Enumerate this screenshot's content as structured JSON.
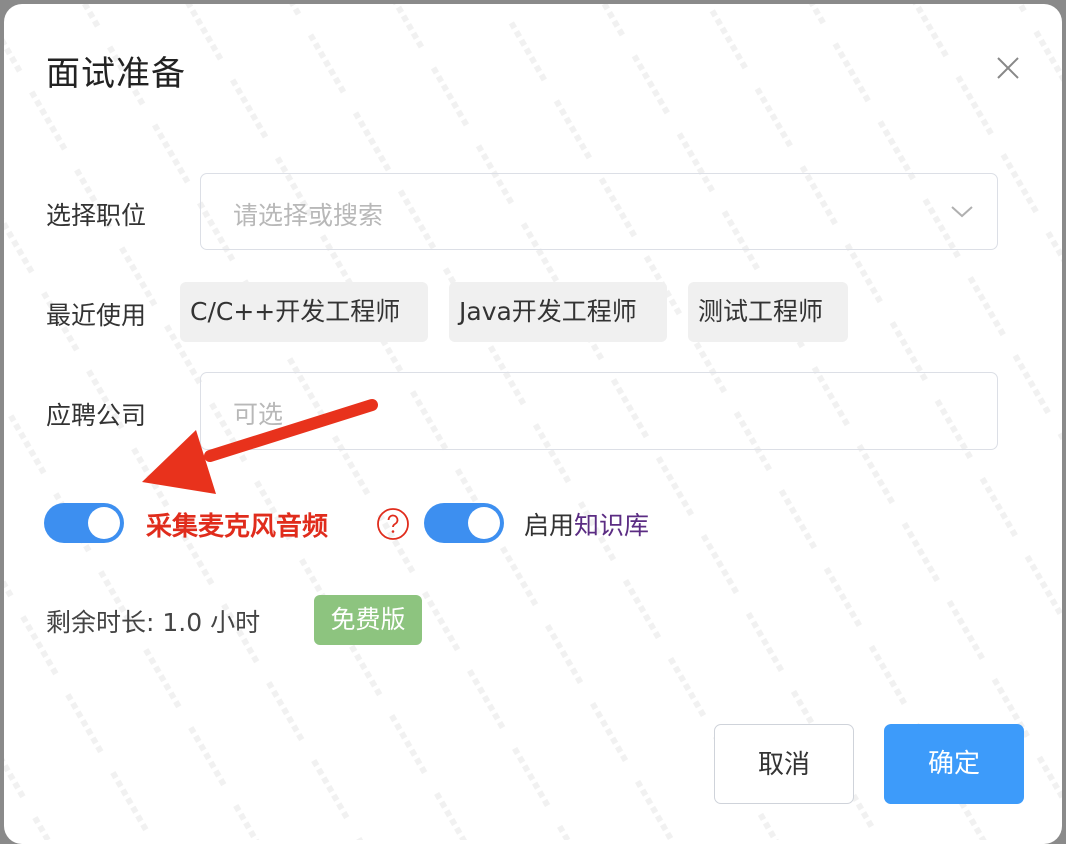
{
  "dialog": {
    "title": "面试准备"
  },
  "form": {
    "position_label": "选择职位",
    "position_placeholder": "请选择或搜索",
    "recent_label": "最近使用",
    "recent_items": [
      "C/C++开发工程师",
      "Java开发工程师",
      "测试工程师"
    ],
    "company_label": "应聘公司",
    "company_placeholder": "可选"
  },
  "toggles": {
    "mic": {
      "label": "采集麦克风音频",
      "enabled": true
    },
    "knowledge": {
      "label_prefix": "启用",
      "label_link": "知识库",
      "enabled": true
    }
  },
  "status": {
    "remaining": "剩余时长: 1.0 小时",
    "plan_badge": "免费版"
  },
  "footer": {
    "cancel_label": "取消",
    "confirm_label": "确定"
  },
  "colors": {
    "accent": "#3d9bfa",
    "switch_on": "#3d8ff0",
    "mic_label": "#e02c1c",
    "annotation_arrow": "#e8321c",
    "badge": "#8dc47f",
    "link": "#5b2c83"
  },
  "icons": {
    "close": "close-icon",
    "dropdown": "chevron-down-icon",
    "help": "question-circle-icon"
  }
}
